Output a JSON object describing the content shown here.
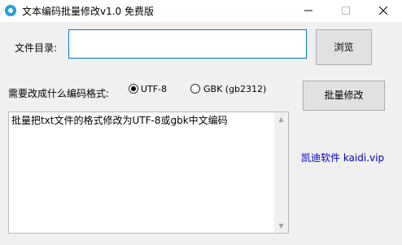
{
  "window": {
    "title": "文本编码批量修改v1.0 免费版",
    "minimize_glyph": "—",
    "close_glyph": "✕"
  },
  "form": {
    "dir_label": "文件目录:",
    "dir_value": "",
    "browse_label": "浏览",
    "encoding_label": "需要改成什么编码格式:",
    "options": [
      {
        "label": "UTF-8",
        "selected": true
      },
      {
        "label": "GBK (gb2312)",
        "selected": false
      }
    ],
    "batch_label": "批量修改"
  },
  "log": {
    "text": "批量把txt文件的格式修改为UTF-8或gbk中文编码"
  },
  "brand": {
    "text": "凯迪软件 kaidi.vip",
    "color": "#0000cc"
  },
  "icons": {
    "app": "app-logo-icon",
    "scroll_up": "chevron-up-icon",
    "scroll_down": "chevron-down-icon"
  }
}
